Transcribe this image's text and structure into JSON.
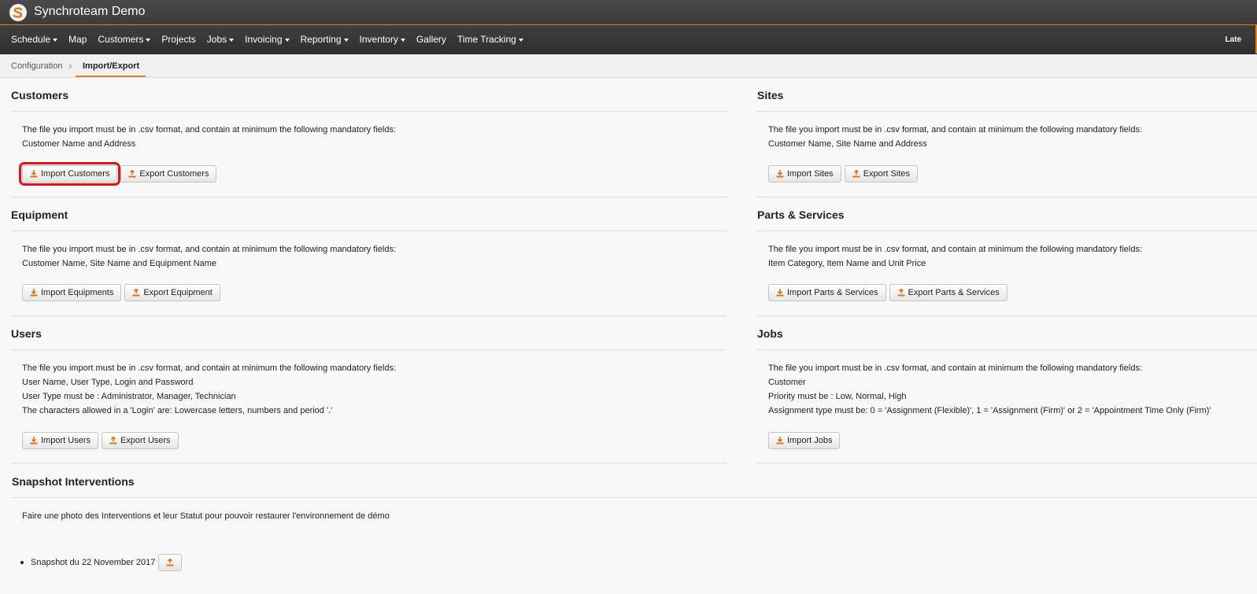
{
  "app": {
    "title": "Synchroteam Demo"
  },
  "nav": {
    "items": [
      {
        "label": "Schedule",
        "dropdown": true
      },
      {
        "label": "Map",
        "dropdown": false
      },
      {
        "label": "Customers",
        "dropdown": true
      },
      {
        "label": "Projects",
        "dropdown": false
      },
      {
        "label": "Jobs",
        "dropdown": true
      },
      {
        "label": "Invoicing",
        "dropdown": true
      },
      {
        "label": "Reporting",
        "dropdown": true
      },
      {
        "label": "Inventory",
        "dropdown": true
      },
      {
        "label": "Gallery",
        "dropdown": false
      },
      {
        "label": "Time Tracking",
        "dropdown": true
      }
    ],
    "right_label": "Late"
  },
  "breadcrumb": {
    "parent": "Configuration",
    "current": "Import/Export"
  },
  "sections": {
    "customers": {
      "title": "Customers",
      "line1": "The file you import must be in .csv format, and contain at minimum the following mandatory fields:",
      "line2": "Customer Name and Address",
      "import_label": "Import Customers",
      "export_label": "Export Customers"
    },
    "sites": {
      "title": "Sites",
      "line1": "The file you import must be in .csv format, and contain at minimum the following mandatory fields:",
      "line2": "Customer Name, Site Name and Address",
      "import_label": "Import Sites",
      "export_label": "Export Sites"
    },
    "equipment": {
      "title": "Equipment",
      "line1": "The file you import must be in .csv format, and contain at minimum the following mandatory fields:",
      "line2": "Customer Name, Site Name and Equipment Name",
      "import_label": "Import Equipments",
      "export_label": "Export Equipment"
    },
    "parts": {
      "title": "Parts & Services",
      "line1": "The file you import must be in .csv format, and contain at minimum the following mandatory fields:",
      "line2": "Item Category, Item Name and Unit Price",
      "import_label": "Import Parts & Services",
      "export_label": "Export Parts & Services"
    },
    "users": {
      "title": "Users",
      "line1": "The file you import must be in .csv format, and contain at minimum the following mandatory fields:",
      "line2": "User Name, User Type, Login and Password",
      "line3": "User Type must be : Administrator, Manager, Technician",
      "line4": "The characters allowed in a 'Login' are: Lowercase letters, numbers and period '.'",
      "import_label": "Import Users",
      "export_label": "Export Users"
    },
    "jobs": {
      "title": "Jobs",
      "line1": "The file you import must be in .csv format, and contain at minimum the following mandatory fields:",
      "line2": "Customer",
      "line3": "Priority must be : Low, Normal, High",
      "line4": "Assignment type must be: 0 = 'Assignment (Flexible)', 1 = 'Assignment (Firm)' or 2 = 'Appointment Time Only (Firm)'",
      "import_label": "Import Jobs"
    },
    "snapshot": {
      "title": "Snapshot Interventions",
      "description": "Faire une photo des Interventions et leur Statut pour pouvoir restaurer l'environnement de démo",
      "items": [
        {
          "label": "Snapshot du 22 November 2017"
        }
      ]
    }
  },
  "colors": {
    "accent": "#e67e22",
    "highlight": "#e0131b",
    "navbar": "#333333"
  },
  "icons": {
    "import": "download-icon",
    "export": "upload-icon"
  }
}
